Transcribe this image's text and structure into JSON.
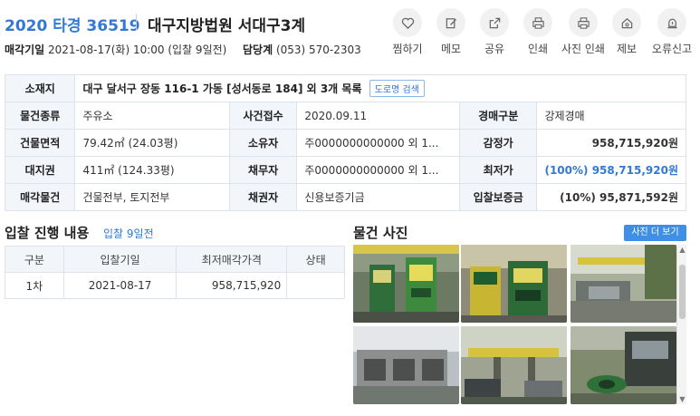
{
  "header": {
    "case_no": "2020 타경 36519",
    "court": "대구지방법원 서대구3계",
    "sale_date_label": "매각기일",
    "sale_date_value": "2021-08-17(화) 10:00 (입찰 9일전)",
    "dept_label": "담당계",
    "dept_value": "(053) 570-2303"
  },
  "actions": [
    {
      "label": "찜하기",
      "icon": "heart-icon"
    },
    {
      "label": "메모",
      "icon": "edit-icon"
    },
    {
      "label": "공유",
      "icon": "share-icon"
    },
    {
      "label": "인쇄",
      "icon": "print-icon"
    },
    {
      "label": "사진 인쇄",
      "icon": "print-icon"
    },
    {
      "label": "제보",
      "icon": "home-report-icon"
    },
    {
      "label": "오류신고",
      "icon": "alert-icon"
    }
  ],
  "info": {
    "location_label": "소재지",
    "location_value": "대구 달서구 장동 116-1 가동 [성서동로 184] 외 3개 목록",
    "road_search": "도로명 검색",
    "rows": [
      {
        "l1": "물건종류",
        "v1": "주유소",
        "l2": "사건접수",
        "v2": "2020.09.11",
        "l3": "경매구분",
        "v3": "강제경매"
      },
      {
        "l1": "건물면적",
        "v1": "79.42㎡ (24.03평)",
        "l2": "소유자",
        "v2": "주0000000000000 외 1...",
        "l3": "감정가",
        "v3": "958,715,920원"
      },
      {
        "l1": "대지권",
        "v1": "411㎡ (124.33평)",
        "l2": "채무자",
        "v2": "주0000000000000 외 1...",
        "l3": "최저가",
        "v3": "(100%) 958,715,920원"
      },
      {
        "l1": "매각물건",
        "v1": "건물전부, 토지전부",
        "l2": "채권자",
        "v2": "신용보증기금",
        "l3": "입찰보증금",
        "v3": "(10%) 95,871,592원"
      }
    ]
  },
  "bid": {
    "title": "입찰 진행 내용",
    "subtitle": "입찰 9일전",
    "headers": [
      "구분",
      "입찰기일",
      "최저매각가격",
      "상태"
    ],
    "rows": [
      {
        "round": "1차",
        "date": "2021-08-17",
        "price": "958,715,920",
        "status": ""
      }
    ]
  },
  "photos": {
    "title": "물건 사진",
    "more_button": "사진 더 보기"
  },
  "colors": {
    "accent": "#2f7ad6",
    "header_bg": "#f2f6fb",
    "border": "#dde3ea"
  }
}
